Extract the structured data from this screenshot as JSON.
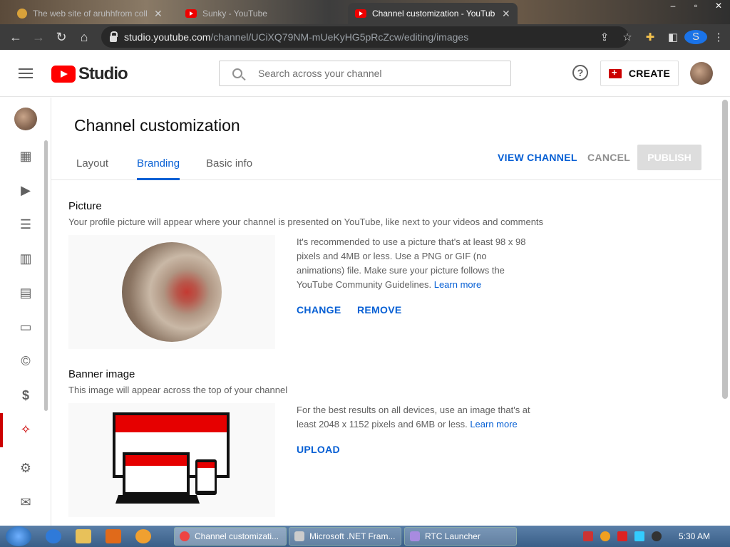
{
  "browser": {
    "tabs": [
      {
        "label": "The web site of aruhhfrom collab",
        "active": false
      },
      {
        "label": "Sunky - YouTube",
        "active": false
      },
      {
        "label": "Channel customization - YouTube",
        "active": true
      }
    ],
    "url_host": "studio.youtube.com",
    "url_path": "/channel/UCiXQ79NM-mUeKyHG5pRcZcw/editing/images",
    "profile_initial": "S"
  },
  "header": {
    "logo_text": "Studio",
    "search_placeholder": "Search across your channel",
    "help_icon": "?",
    "create_label": "CREATE"
  },
  "page": {
    "title": "Channel customization",
    "tabs": [
      {
        "label": "Layout",
        "active": false
      },
      {
        "label": "Branding",
        "active": true
      },
      {
        "label": "Basic info",
        "active": false
      }
    ],
    "view_channel": "VIEW CHANNEL",
    "cancel": "CANCEL",
    "publish": "PUBLISH"
  },
  "picture": {
    "heading": "Picture",
    "description": "Your profile picture will appear where your channel is presented on YouTube, like next to your videos and comments",
    "info": "It's recommended to use a picture that's at least 98 x 98 pixels and 4MB or less. Use a PNG or GIF (no animations) file. Make sure your picture follows the YouTube Community Guidelines.",
    "learn_more": "Learn more",
    "change": "CHANGE",
    "remove": "REMOVE"
  },
  "banner": {
    "heading": "Banner image",
    "description": "This image will appear across the top of your channel",
    "info": "For the best results on all devices, use an image that's at least 2048 x 1152 pixels and 6MB or less.",
    "learn_more": "Learn more",
    "upload": "UPLOAD"
  },
  "sidebar": {
    "items": [
      "dashboard",
      "content",
      "playlists",
      "analytics",
      "comments",
      "subtitles",
      "copyright",
      "earn",
      "customization",
      "settings",
      "send-feedback"
    ],
    "active": "customization"
  },
  "taskbar": {
    "tasks": [
      "Channel customizati...",
      "Microsoft .NET Fram...",
      "RTC Launcher"
    ],
    "clock": "5:30 AM"
  },
  "colors": {
    "accent": "#065fd4",
    "brand": "#ff0000",
    "active_bar": "#cc0000"
  }
}
